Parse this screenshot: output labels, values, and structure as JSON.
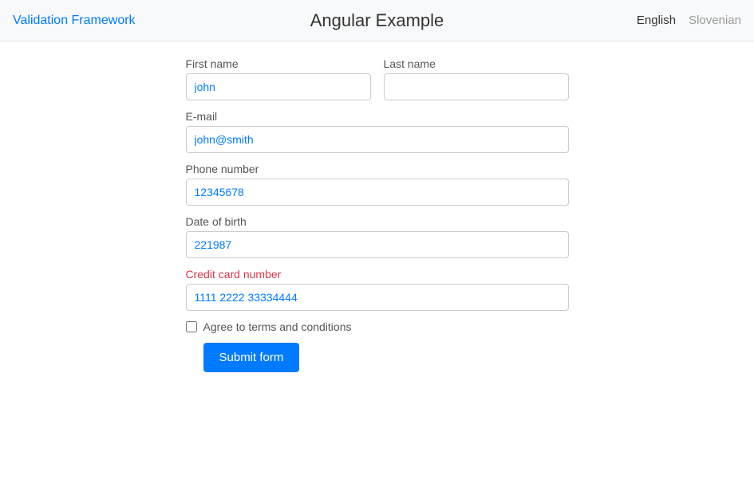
{
  "navbar": {
    "brand_prefix": "Validation ",
    "brand_highlight": "Framework",
    "title": "Angular Example",
    "links": [
      {
        "label": "English",
        "active": true
      },
      {
        "label": "Slovenian",
        "active": false
      }
    ]
  },
  "form": {
    "first_name_label": "First name",
    "first_name_value": "john",
    "last_name_label": "Last name",
    "last_name_value": "",
    "email_label": "E-mail",
    "email_value": "john@smith",
    "phone_label": "Phone number",
    "phone_value": "12345678",
    "dob_label": "Date of birth",
    "dob_value": "221987",
    "credit_card_label": "Credit card number",
    "credit_card_value": "1111 2222 33334444",
    "terms_label": "Agree to terms and conditions",
    "submit_label": "Submit form"
  }
}
